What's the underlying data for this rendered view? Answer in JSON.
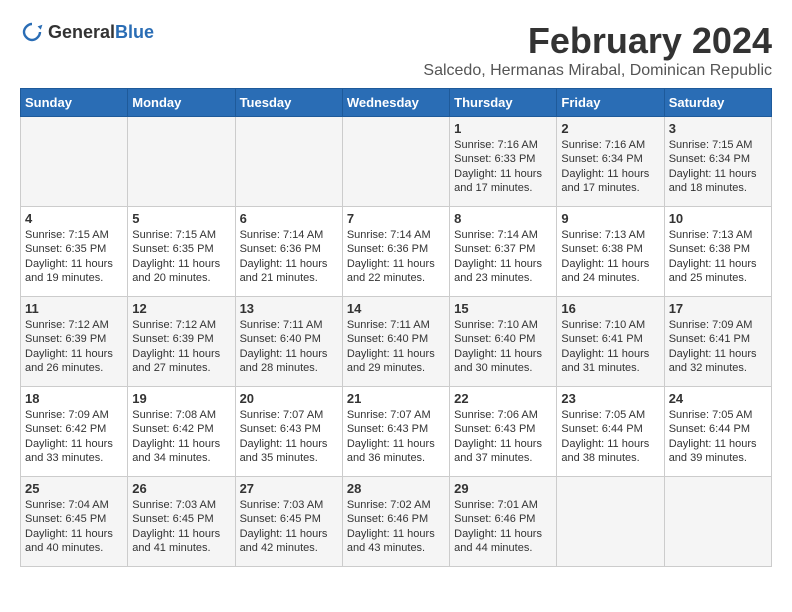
{
  "logo": {
    "text_general": "General",
    "text_blue": "Blue"
  },
  "title": "February 2024",
  "location": "Salcedo, Hermanas Mirabal, Dominican Republic",
  "days_header": [
    "Sunday",
    "Monday",
    "Tuesday",
    "Wednesday",
    "Thursday",
    "Friday",
    "Saturday"
  ],
  "weeks": [
    [
      {
        "day": "",
        "info": ""
      },
      {
        "day": "",
        "info": ""
      },
      {
        "day": "",
        "info": ""
      },
      {
        "day": "",
        "info": ""
      },
      {
        "day": "1",
        "info": "Sunrise: 7:16 AM\nSunset: 6:33 PM\nDaylight: 11 hours and 17 minutes."
      },
      {
        "day": "2",
        "info": "Sunrise: 7:16 AM\nSunset: 6:34 PM\nDaylight: 11 hours and 17 minutes."
      },
      {
        "day": "3",
        "info": "Sunrise: 7:15 AM\nSunset: 6:34 PM\nDaylight: 11 hours and 18 minutes."
      }
    ],
    [
      {
        "day": "4",
        "info": "Sunrise: 7:15 AM\nSunset: 6:35 PM\nDaylight: 11 hours and 19 minutes."
      },
      {
        "day": "5",
        "info": "Sunrise: 7:15 AM\nSunset: 6:35 PM\nDaylight: 11 hours and 20 minutes."
      },
      {
        "day": "6",
        "info": "Sunrise: 7:14 AM\nSunset: 6:36 PM\nDaylight: 11 hours and 21 minutes."
      },
      {
        "day": "7",
        "info": "Sunrise: 7:14 AM\nSunset: 6:36 PM\nDaylight: 11 hours and 22 minutes."
      },
      {
        "day": "8",
        "info": "Sunrise: 7:14 AM\nSunset: 6:37 PM\nDaylight: 11 hours and 23 minutes."
      },
      {
        "day": "9",
        "info": "Sunrise: 7:13 AM\nSunset: 6:38 PM\nDaylight: 11 hours and 24 minutes."
      },
      {
        "day": "10",
        "info": "Sunrise: 7:13 AM\nSunset: 6:38 PM\nDaylight: 11 hours and 25 minutes."
      }
    ],
    [
      {
        "day": "11",
        "info": "Sunrise: 7:12 AM\nSunset: 6:39 PM\nDaylight: 11 hours and 26 minutes."
      },
      {
        "day": "12",
        "info": "Sunrise: 7:12 AM\nSunset: 6:39 PM\nDaylight: 11 hours and 27 minutes."
      },
      {
        "day": "13",
        "info": "Sunrise: 7:11 AM\nSunset: 6:40 PM\nDaylight: 11 hours and 28 minutes."
      },
      {
        "day": "14",
        "info": "Sunrise: 7:11 AM\nSunset: 6:40 PM\nDaylight: 11 hours and 29 minutes."
      },
      {
        "day": "15",
        "info": "Sunrise: 7:10 AM\nSunset: 6:40 PM\nDaylight: 11 hours and 30 minutes."
      },
      {
        "day": "16",
        "info": "Sunrise: 7:10 AM\nSunset: 6:41 PM\nDaylight: 11 hours and 31 minutes."
      },
      {
        "day": "17",
        "info": "Sunrise: 7:09 AM\nSunset: 6:41 PM\nDaylight: 11 hours and 32 minutes."
      }
    ],
    [
      {
        "day": "18",
        "info": "Sunrise: 7:09 AM\nSunset: 6:42 PM\nDaylight: 11 hours and 33 minutes."
      },
      {
        "day": "19",
        "info": "Sunrise: 7:08 AM\nSunset: 6:42 PM\nDaylight: 11 hours and 34 minutes."
      },
      {
        "day": "20",
        "info": "Sunrise: 7:07 AM\nSunset: 6:43 PM\nDaylight: 11 hours and 35 minutes."
      },
      {
        "day": "21",
        "info": "Sunrise: 7:07 AM\nSunset: 6:43 PM\nDaylight: 11 hours and 36 minutes."
      },
      {
        "day": "22",
        "info": "Sunrise: 7:06 AM\nSunset: 6:43 PM\nDaylight: 11 hours and 37 minutes."
      },
      {
        "day": "23",
        "info": "Sunrise: 7:05 AM\nSunset: 6:44 PM\nDaylight: 11 hours and 38 minutes."
      },
      {
        "day": "24",
        "info": "Sunrise: 7:05 AM\nSunset: 6:44 PM\nDaylight: 11 hours and 39 minutes."
      }
    ],
    [
      {
        "day": "25",
        "info": "Sunrise: 7:04 AM\nSunset: 6:45 PM\nDaylight: 11 hours and 40 minutes."
      },
      {
        "day": "26",
        "info": "Sunrise: 7:03 AM\nSunset: 6:45 PM\nDaylight: 11 hours and 41 minutes."
      },
      {
        "day": "27",
        "info": "Sunrise: 7:03 AM\nSunset: 6:45 PM\nDaylight: 11 hours and 42 minutes."
      },
      {
        "day": "28",
        "info": "Sunrise: 7:02 AM\nSunset: 6:46 PM\nDaylight: 11 hours and 43 minutes."
      },
      {
        "day": "29",
        "info": "Sunrise: 7:01 AM\nSunset: 6:46 PM\nDaylight: 11 hours and 44 minutes."
      },
      {
        "day": "",
        "info": ""
      },
      {
        "day": "",
        "info": ""
      }
    ]
  ]
}
